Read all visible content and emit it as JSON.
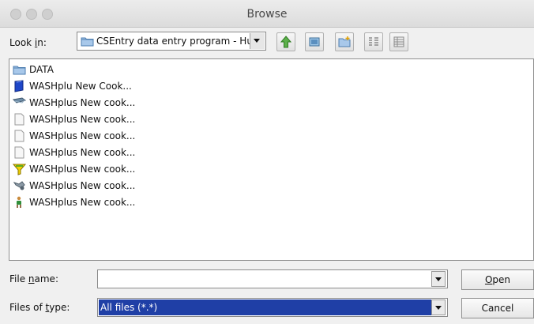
{
  "window": {
    "title": "Browse"
  },
  "toolbar": {
    "look_in_prefix": "Look ",
    "look_in_mnemonic": "i",
    "look_in_suffix": "n:",
    "location": "CSEntry data entry program - Hu",
    "buttons": [
      "up-one-level",
      "desktop",
      "create-new-folder",
      "list-view",
      "details-view"
    ]
  },
  "files": [
    {
      "name": "DATA",
      "icon": "folder-icon"
    },
    {
      "name": "WASHplu New Cook...",
      "icon": "book-icon"
    },
    {
      "name": "WASHplus New cook...",
      "icon": "image-icon"
    },
    {
      "name": "WASHplus New cook...",
      "icon": "document-icon"
    },
    {
      "name": "WASHplus New cook...",
      "icon": "document-icon"
    },
    {
      "name": "WASHplus New cook...",
      "icon": "document-icon"
    },
    {
      "name": "WASHplus New cook...",
      "icon": "funnel-icon"
    },
    {
      "name": "WASHplus New cook...",
      "icon": "tools-icon"
    },
    {
      "name": "WASHplus New cook...",
      "icon": "figure-icon"
    }
  ],
  "file_name": {
    "label_prefix": "File ",
    "label_mnemonic": "n",
    "label_suffix": "ame:",
    "value": ""
  },
  "file_type": {
    "label_prefix": "Files of ",
    "label_mnemonic": "t",
    "label_suffix": "ype:",
    "value": "All files (*.*)"
  },
  "buttons": {
    "open_mnemonic": "O",
    "open_rest": "pen",
    "cancel": "Cancel"
  }
}
